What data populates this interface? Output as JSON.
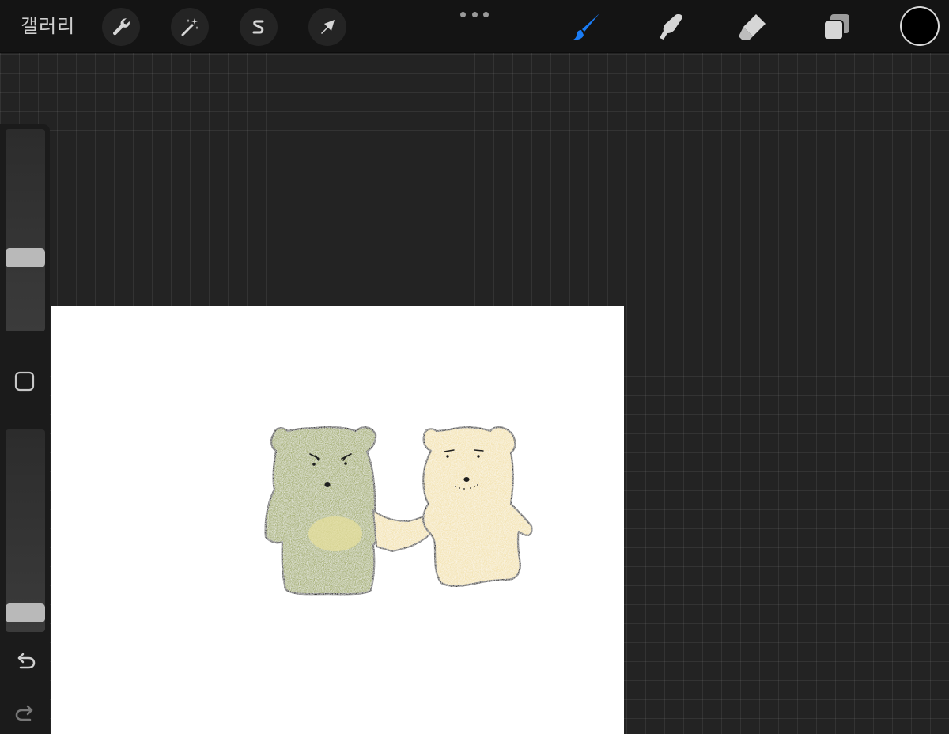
{
  "toolbar": {
    "gallery_label": "갤러리",
    "actions_icon": "wrench-icon",
    "adjustments_icon": "magic-wand-icon",
    "selection_icon": "selection-s-icon",
    "transform_icon": "arrow-cursor-icon",
    "more_icon": "more-dots-icon",
    "brush_icon": "brush-icon",
    "smudge_icon": "smudge-finger-icon",
    "eraser_icon": "eraser-icon",
    "layers_icon": "layers-icon",
    "active_tool": "brush",
    "accent_color": "#1a7cf5",
    "current_color": "#000000"
  },
  "sidebar": {
    "brush_size_level": 0.35,
    "opacity_level": 0.05,
    "modify_icon": "square-icon",
    "undo_icon": "undo-icon",
    "redo_icon": "redo-icon"
  },
  "canvas": {
    "background": "#ffffff",
    "artwork": "two-bears-holding-hands",
    "colors": {
      "green_bear": "#a3ad6c",
      "yellow_bear": "#f3e2ae",
      "outline": "#1e1e1e"
    }
  }
}
